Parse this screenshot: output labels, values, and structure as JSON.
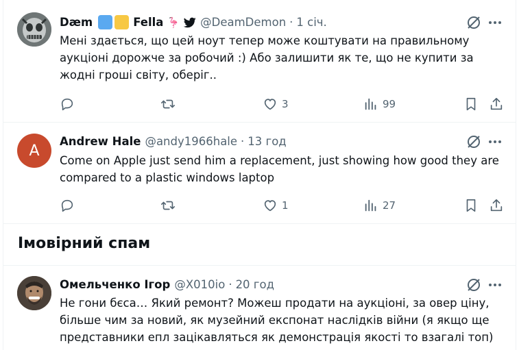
{
  "tweets": [
    {
      "name": "Dæm",
      "name_suffix": "Fella",
      "emoji_colors": [
        "#5aa9f0",
        "#f7c844"
      ],
      "flamingo_glyph": "🦩",
      "handle": "@DeamDemon",
      "separator": "·",
      "time": "1 січ.",
      "text": "Мені здається, що цей ноут тепер може коштувати на правильному аукціоні дорожче за робочий :) Або залишити як те, що не купити за жодні гроші світу, оберіг..",
      "likes": "3",
      "views": "99"
    },
    {
      "name": "Andrew Hale",
      "avatar_letter": "A",
      "handle": "@andy1966hale",
      "separator": "·",
      "time": "13 год",
      "text": "Come on Apple just send him a replacement, just showing how good they are compared to a plastic windows laptop",
      "likes": "1",
      "views": "27"
    },
    {
      "name": "Омельченко Ігор",
      "handle": "@X010io",
      "separator": "·",
      "time": "20 год",
      "text": "Не гони бєса… Який ремонт? Можеш продати на аукціоні, за овер ціну, більше чим за новий, як музейний експонат наслідків війни (я  якщо ще представники епл зацікавляться як демонстрація якості то взагалі топ)"
    }
  ],
  "section": {
    "title": "Імовірний спам"
  },
  "colors": {
    "muted": "#536471",
    "text": "#0f1419",
    "border": "#eff3f4",
    "avatar_red": "#c84a2d"
  },
  "icons": [
    "reply-icon",
    "retweet-icon",
    "like-icon",
    "views-icon",
    "bookmark-icon",
    "share-icon",
    "grok-icon",
    "more-icon",
    "verified-bird-icon"
  ]
}
